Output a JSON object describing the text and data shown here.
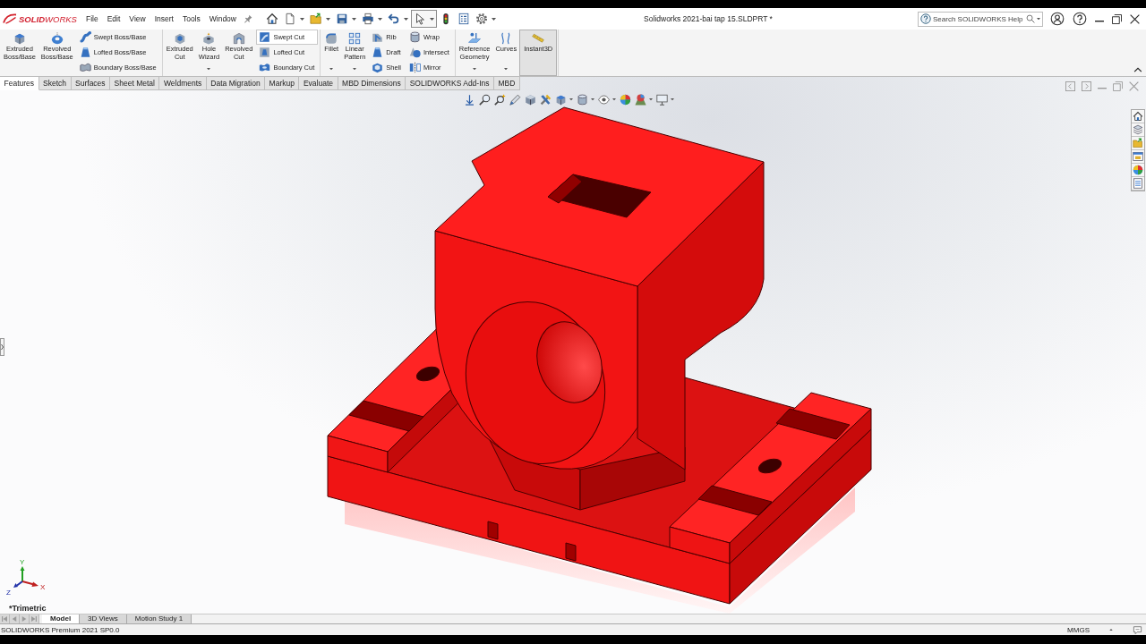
{
  "title_bar": {
    "logo": "**SOLID**WORKS",
    "menu": [
      "File",
      "Edit",
      "View",
      "Insert",
      "Tools",
      "Window"
    ],
    "quick_access": [
      {
        "dropdown": false,
        "selected": false
      },
      {
        "dropdown": true,
        "selected": false
      },
      {
        "dropdown": true,
        "selected": false
      },
      {
        "dropdown": true,
        "selected": false
      },
      {
        "dropdown": true,
        "selected": false
      },
      {
        "dropdown": true,
        "selected": false
      },
      {
        "dropdown": true,
        "selected": true
      },
      {
        "dropdown": false,
        "selected": false
      },
      {
        "dropdown": false,
        "selected": false
      },
      {
        "dropdown": true,
        "selected": false
      }
    ],
    "document_title": "Solidworks 2021-bai tap 15.SLDPRT *",
    "search": {
      "placeholder": "Search SOLIDWORKS Help"
    }
  },
  "ribbon": {
    "groups": [
      {
        "large": [
          {
            "label": "Extruded\nBoss/Base",
            "dropdown": false,
            "on": false
          },
          {
            "label": "Revolved\nBoss/Base",
            "dropdown": false,
            "on": false
          }
        ],
        "small_columns": [
          [
            {
              "label": "Swept Boss/Base",
              "highlighted": false
            },
            {
              "label": "Lofted Boss/Base",
              "highlighted": false
            },
            {
              "label": "Boundary Boss/Base",
              "highlighted": false
            }
          ]
        ]
      },
      {
        "large": [
          {
            "label": "Extruded\nCut",
            "dropdown": false,
            "on": false
          },
          {
            "label": "Hole\nWizard",
            "dropdown": true,
            "on": false
          },
          {
            "label": "Revolved\nCut",
            "dropdown": false,
            "on": false
          }
        ],
        "small_columns": [
          [
            {
              "label": "Swept Cut",
              "highlighted": true
            },
            {
              "label": "Lofted Cut",
              "highlighted": false
            },
            {
              "label": "Boundary Cut",
              "highlighted": false
            }
          ]
        ]
      },
      {
        "large": [
          {
            "label": "Fillet",
            "dropdown": true,
            "on": false
          },
          {
            "label": "Linear\nPattern",
            "dropdown": true,
            "on": false
          }
        ],
        "small_columns": [
          [
            {
              "label": "Rib",
              "highlighted": false
            },
            {
              "label": "Draft",
              "highlighted": false
            },
            {
              "label": "Shell",
              "highlighted": false
            }
          ],
          [
            {
              "label": "Wrap",
              "highlighted": false
            },
            {
              "label": "Intersect",
              "highlighted": false
            },
            {
              "label": "Mirror",
              "highlighted": false
            }
          ]
        ]
      },
      {
        "large": [
          {
            "label": "Reference\nGeometry",
            "dropdown": true,
            "on": false
          },
          {
            "label": "Curves",
            "dropdown": true,
            "on": false
          },
          {
            "label": "Instant3D",
            "dropdown": false,
            "on": true
          }
        ]
      }
    ]
  },
  "tabs": [
    {
      "label": "Features",
      "selected": true
    },
    {
      "label": "Sketch",
      "selected": false
    },
    {
      "label": "Surfaces",
      "selected": false
    },
    {
      "label": "Sheet Metal",
      "selected": false
    },
    {
      "label": "Weldments",
      "selected": false
    },
    {
      "label": "Data Migration",
      "selected": false
    },
    {
      "label": "Markup",
      "selected": false
    },
    {
      "label": "Evaluate",
      "selected": false
    },
    {
      "label": "MBD Dimensions",
      "selected": false
    },
    {
      "label": "SOLIDWORKS Add-Ins",
      "selected": false
    },
    {
      "label": "MBD",
      "selected": false
    }
  ],
  "viewport": {
    "view_name": "*Trimetric",
    "triad": {
      "x": "X",
      "y": "Y",
      "z": "Z"
    }
  },
  "bottom_tabs": [
    {
      "label": "Model",
      "selected": true
    },
    {
      "label": "3D Views",
      "selected": false
    },
    {
      "label": "Motion Study 1",
      "selected": false
    }
  ],
  "status_bar": {
    "product": "SOLIDWORKS Premium 2021 SP0.0",
    "units": "MMGS"
  }
}
